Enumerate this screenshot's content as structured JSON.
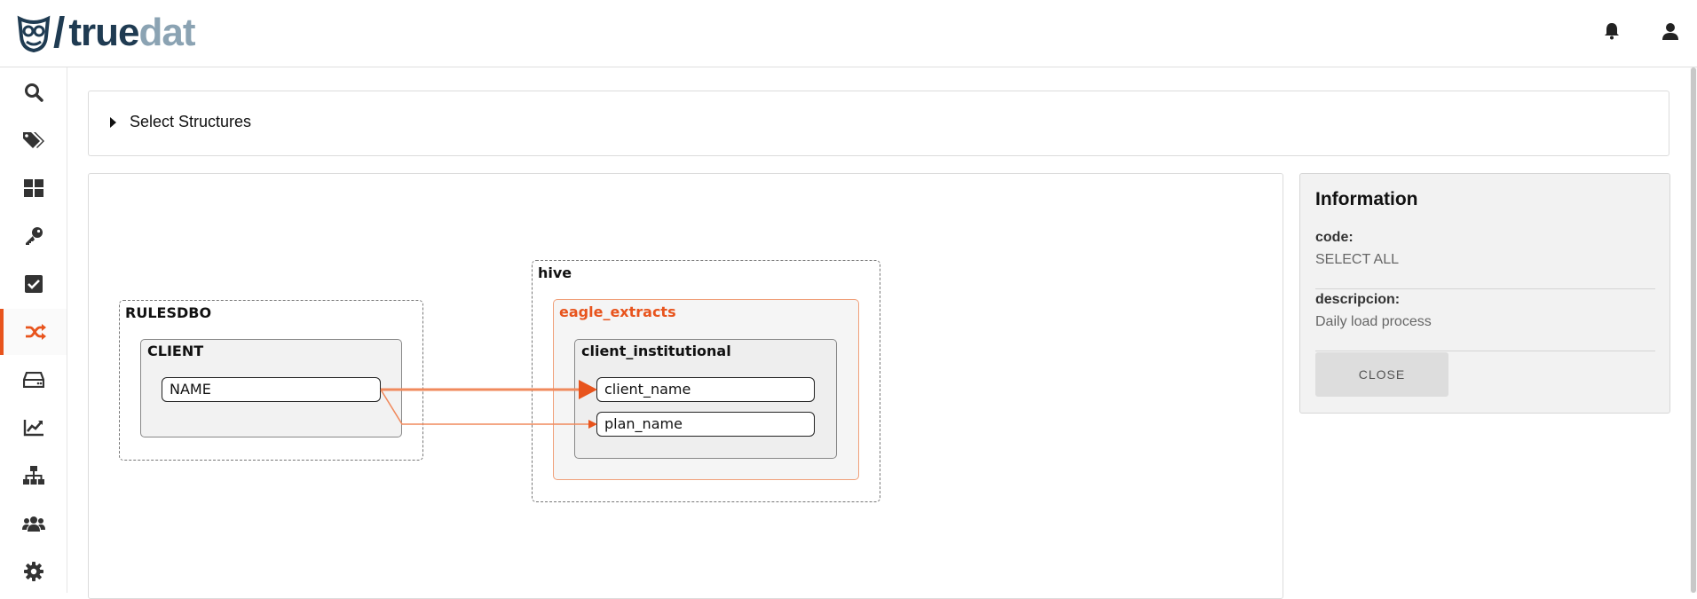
{
  "app": {
    "logo_true": "true",
    "logo_dat": "dat"
  },
  "header": {
    "icons": [
      "bell-icon",
      "user-icon"
    ]
  },
  "sidebar": {
    "items": [
      {
        "icon": "search-icon",
        "active": false
      },
      {
        "icon": "tags-icon",
        "active": false
      },
      {
        "icon": "dashboard-icon",
        "active": false
      },
      {
        "icon": "key-icon",
        "active": false
      },
      {
        "icon": "checkbox-icon",
        "active": false
      },
      {
        "icon": "shuffle-icon",
        "active": true
      },
      {
        "icon": "storage-icon",
        "active": false
      },
      {
        "icon": "chart-line-icon",
        "active": false
      },
      {
        "icon": "hierarchy-icon",
        "active": false
      },
      {
        "icon": "users-icon",
        "active": false
      },
      {
        "icon": "gear-icon",
        "active": false
      }
    ],
    "active_color": "#e8541d"
  },
  "select_structures": {
    "label": "Select Structures"
  },
  "graph": {
    "source_group": "RULESDBO",
    "source_table": "CLIENT",
    "source_field": "NAME",
    "target_group": "hive",
    "target_schema": "eagle_extracts",
    "target_table": "client_institutional",
    "target_fields": [
      "client_name",
      "plan_name"
    ],
    "edge_color": "#f08a5d",
    "highlight_color": "#e8541d"
  },
  "info": {
    "title": "Information",
    "code_label": "code:",
    "code_value": "SELECT ALL",
    "descripcion_label": "descripcion:",
    "descripcion_value": "Daily load process",
    "close_label": "CLOSE"
  }
}
